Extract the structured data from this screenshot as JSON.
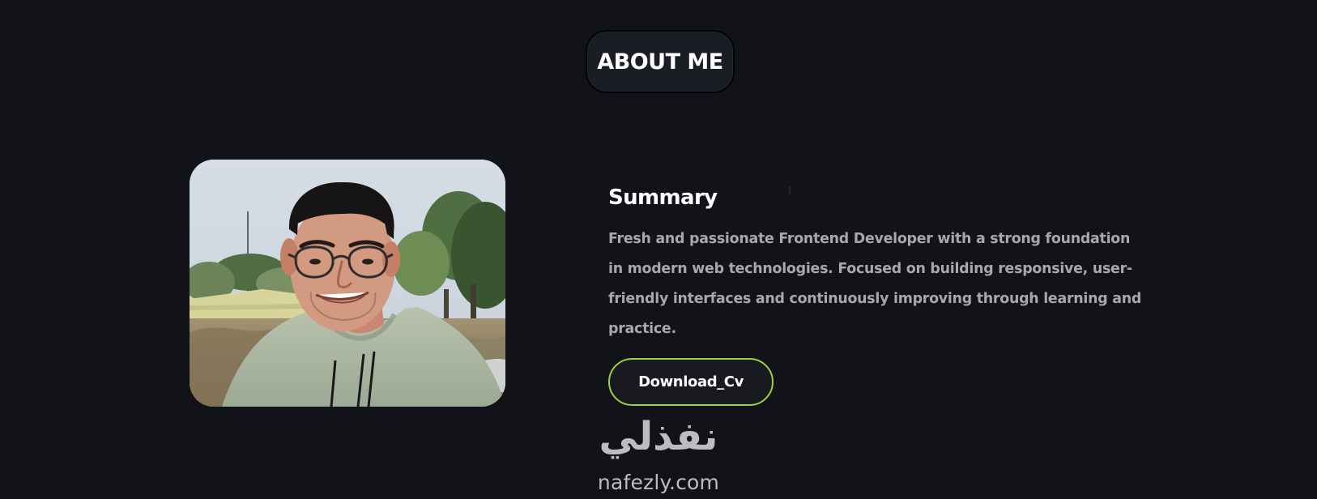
{
  "section": {
    "heading": "ABOUT ME"
  },
  "profile": {
    "photo_icon": "profile-photo"
  },
  "summary": {
    "title": "Summary",
    "text": "Fresh and passionate Frontend Developer with a strong foundation in modern web technologies. Focused on building responsive, user-friendly interfaces and continuously improving through learning and practice."
  },
  "actions": {
    "download_label": "Download_Cv"
  },
  "watermark": {
    "arabic": "نفذلي",
    "latin": "nafezly.com"
  },
  "colors": {
    "background": "#111318",
    "accent": "#9bd23c",
    "heading": "#ffffff",
    "body_text": "#a7a7ad"
  }
}
